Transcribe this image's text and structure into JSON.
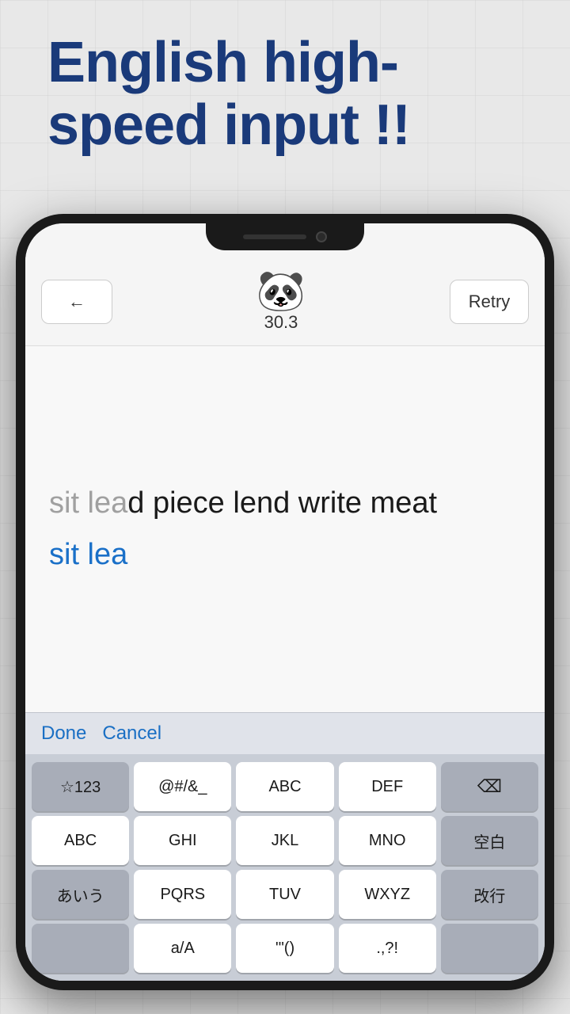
{
  "header": {
    "title_line1": "English high-",
    "title_line2": "speed input !!"
  },
  "app_bar": {
    "back_label": "←",
    "panda_emoji": "🐼",
    "score": "30.3",
    "retry_label": "Retry"
  },
  "text_display": {
    "target_completed": "sit lea",
    "target_remaining": "d piece lend write meat",
    "typed_text": "sit lea"
  },
  "keyboard_toolbar": {
    "done_label": "Done",
    "cancel_label": "Cancel"
  },
  "keyboard": {
    "row1": [
      "☆123",
      "@#/&_",
      "ABC",
      "DEF",
      "⌫"
    ],
    "row2": [
      "ABC",
      "GHI",
      "JKL",
      "MNO",
      "空白"
    ],
    "row3_left": "あいう",
    "row3_mid": [
      "PQRS",
      "TUV",
      "WXYZ"
    ],
    "row3_right": "改行",
    "row4_mid": [
      "a/A",
      "'\"()",
      ".,?!"
    ]
  }
}
